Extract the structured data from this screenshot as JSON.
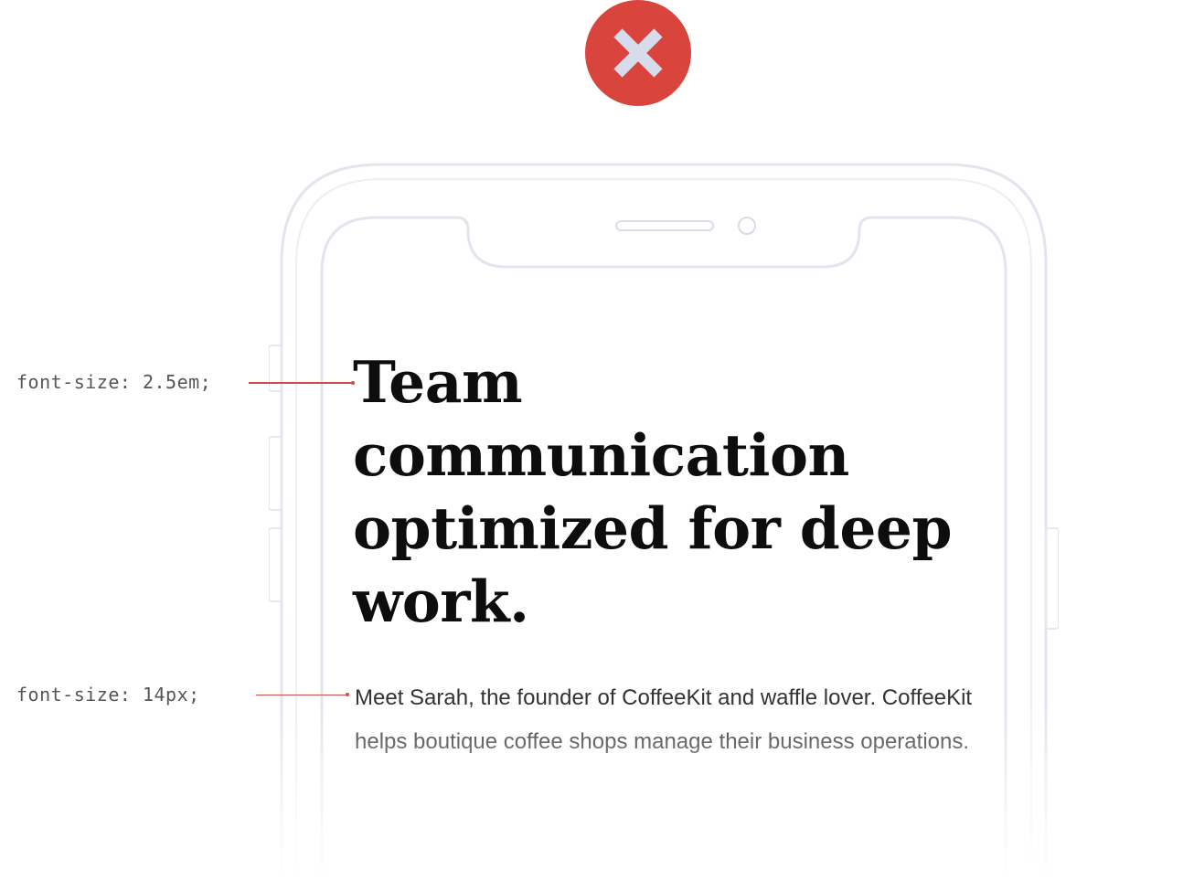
{
  "badge": {
    "icon": "close-icon",
    "color": "#d9443c",
    "meaning": "incorrect"
  },
  "annotations": [
    {
      "label": "font-size: 2.5em;"
    },
    {
      "label": "font-size: 14px;"
    }
  ],
  "content": {
    "headline": "Team communication optimized for deep work.",
    "body": "Meet Sarah, the founder of CoffeeKit and waffle lover. CoffeeKit helps boutique coffee shops manage their business operations."
  },
  "colors": {
    "annotation_line": "#cf4a4a",
    "phone_outline": "#dfe3ec",
    "headline_text": "#0d0d0d",
    "body_text": "#333333"
  }
}
